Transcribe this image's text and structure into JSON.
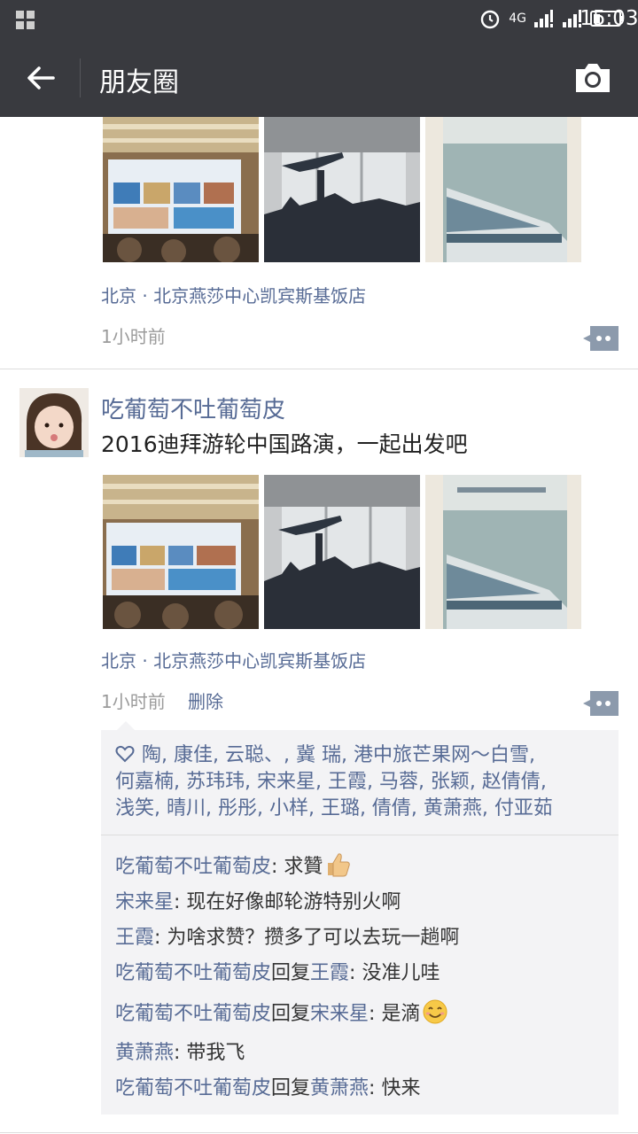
{
  "status_bar": {
    "network": "4G",
    "time": "15:03"
  },
  "nav": {
    "title": "朋友圈"
  },
  "post_prev": {
    "location": "北京 · 北京燕莎中心凯宾斯基饭店",
    "time": "1小时前"
  },
  "post": {
    "user": "吃葡萄不吐葡萄皮",
    "text": "2016迪拜游轮中国路演，一起出发吧",
    "location": "北京 · 北京燕莎中心凯宾斯基饭店",
    "time": "1小时前",
    "delete_label": "删除",
    "likes_line1": "陶, 康佳, 云聪、, 冀 瑞, 港中旅芒果网～白雪,",
    "likes_line2": "何嘉楠, 苏玮玮, 宋来星, 王霞, 马蓉, 张颖, 赵倩倩,",
    "likes_line3": "浅笑, 晴川, 彤彤, 小样, 王璐, 倩倩, 黄萧燕, 付亚茹",
    "comments": [
      {
        "name": "吃葡萄不吐葡萄皮",
        "reply_word": "",
        "reply_to": "",
        "text": ": 求贊"
      },
      {
        "name": "宋来星",
        "reply_word": "",
        "reply_to": "",
        "text": ": 现在好像邮轮游特别火啊"
      },
      {
        "name": "王霞",
        "reply_word": "",
        "reply_to": "",
        "text": ": 为啥求赞？攒多了可以去玩一趟啊"
      },
      {
        "name": "吃葡萄不吐葡萄皮",
        "reply_word": "回复",
        "reply_to": "王霞",
        "text": ": 没准儿哇"
      },
      {
        "name": "吃葡萄不吐葡萄皮",
        "reply_word": "回复",
        "reply_to": "宋来星",
        "text": ": 是滴"
      },
      {
        "name": "黄萧燕",
        "reply_word": "",
        "reply_to": "",
        "text": ": 带我飞"
      },
      {
        "name": "吃葡萄不吐葡萄皮",
        "reply_word": "回复",
        "reply_to": "黄萧燕",
        "text": ": 快来"
      }
    ]
  },
  "icons": {
    "back": "arrow-left-icon",
    "camera": "camera-icon",
    "comment": "comment-dots-icon",
    "heart": "heart-outline-icon",
    "thumbs_up": "thumbs-up-emoji",
    "smile": "smile-emoji"
  },
  "colors": {
    "bar": "#393a3f",
    "link": "#576b95",
    "time": "#9b9b9b",
    "box": "#f3f3f5"
  }
}
